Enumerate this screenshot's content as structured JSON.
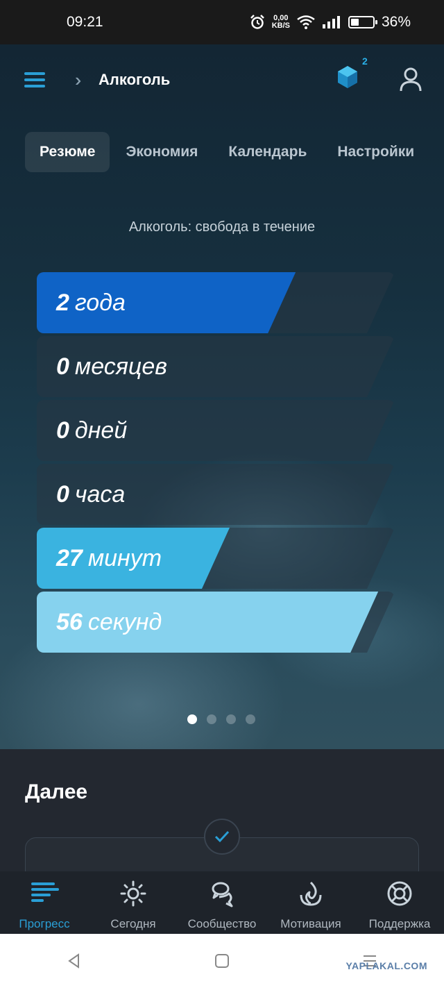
{
  "status_bar": {
    "time": "09:21",
    "net_speed_value": "0,00",
    "net_speed_unit": "KB/S",
    "battery_percent": "36%",
    "battery_level": 0.36
  },
  "header": {
    "title": "Алкоголь",
    "badge_count": "2",
    "accent_color": "#2a9fd6"
  },
  "tabs": [
    {
      "label": "Резюме",
      "active": true
    },
    {
      "label": "Экономия",
      "active": false
    },
    {
      "label": "Календарь",
      "active": false
    },
    {
      "label": "Настройки",
      "active": false
    }
  ],
  "summary": {
    "subtitle": "Алкоголь: свобода в течение",
    "items": [
      {
        "value": "2",
        "unit": "года",
        "fill": 0.7,
        "color": "#0f63c6"
      },
      {
        "value": "0",
        "unit": "месяцев",
        "fill": 0.0,
        "color": "#1a70c0"
      },
      {
        "value": "0",
        "unit": "дней",
        "fill": 0.0,
        "color": "#1a70c0"
      },
      {
        "value": "0",
        "unit": "часа",
        "fill": 0.0,
        "color": "#1a70c0"
      },
      {
        "value": "27",
        "unit": "минут",
        "fill": 0.5,
        "color": "#3ab3e0"
      },
      {
        "value": "56",
        "unit": "секунд",
        "fill": 0.95,
        "color": "#86d2ee"
      }
    ],
    "page_count": 4,
    "active_page": 1
  },
  "next": {
    "title": "Далее"
  },
  "bottom_nav": [
    {
      "label": "Прогресс",
      "icon": "progress-icon",
      "active": true
    },
    {
      "label": "Сегодня",
      "icon": "sun-icon",
      "active": false
    },
    {
      "label": "Сообщество",
      "icon": "community-icon",
      "active": false
    },
    {
      "label": "Мотивация",
      "icon": "motivation-icon",
      "active": false
    },
    {
      "label": "Поддержка",
      "icon": "lifebuoy-icon",
      "active": false
    }
  ],
  "watermark": "YAPLAKAL.COM"
}
